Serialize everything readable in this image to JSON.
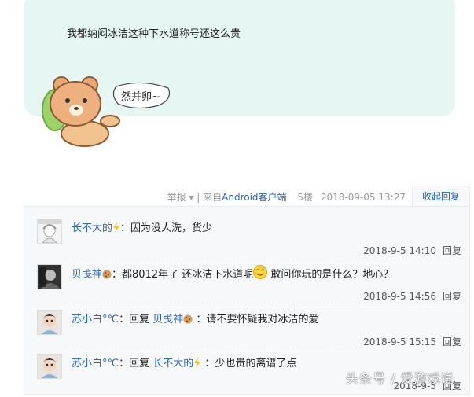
{
  "post": {
    "text": "我都纳闷冰洁这种下水道称号还这么贵",
    "sticker_text": "然并卵~"
  },
  "tail": {
    "report_label": "举报",
    "separator": "|",
    "source_label": "来自Android客户端",
    "floor": "5楼",
    "time": "2018-09-05 13:27",
    "fold_label": "收起回复"
  },
  "comments": [
    {
      "user": "长不大的",
      "user_badge_icon": "lightning-icon",
      "text": "因为没人洗，货少",
      "time": "2018-9-5 14:10",
      "reply_label": "回复"
    },
    {
      "user": "贝戋神",
      "user_badge_icon": "cookie-icon",
      "text_before": "都8012年了 还冰洁下水道呢",
      "emoji": "sweat-smile-emoji",
      "text_after": " 敢问你玩的是什么？地心？",
      "time": "2018-9-5 14:56",
      "reply_label": "回复"
    },
    {
      "user": "苏小白°℃",
      "reply_prefix": "回复",
      "reply_target": "贝戋神",
      "target_badge_icon": "cookie-icon",
      "text": "请不要怀疑我对冰洁的爱",
      "time": "2018-9-5 15:15",
      "reply_label": "回复"
    },
    {
      "user": "苏小白°℃",
      "reply_prefix": "回复",
      "reply_target": "长不大的",
      "target_badge_icon": "lightning-icon",
      "text": "少也贵的离谱了点",
      "time": "2018-9-5",
      "reply_label": "回复"
    }
  ],
  "watermark": "头条号 / 爱游戏说",
  "colors": {
    "bubble": "#e6f6f3",
    "link": "#2d64b3",
    "panel": "#f7f8fa"
  }
}
